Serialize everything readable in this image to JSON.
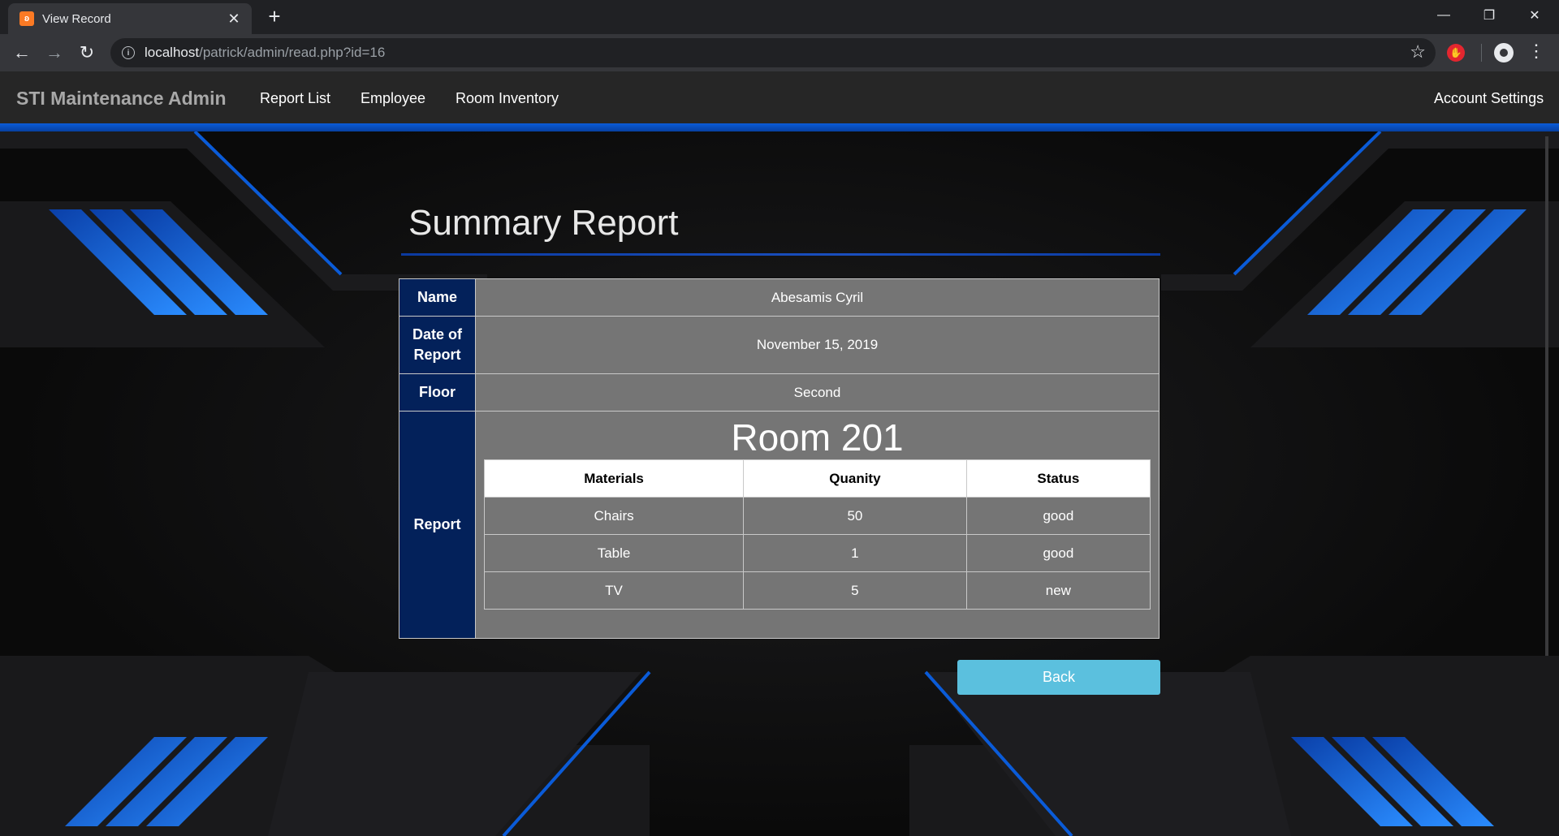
{
  "browser": {
    "tab_title": "View Record",
    "tab_close": "✕",
    "new_tab": "+",
    "url_host": "localhost",
    "url_path": "/patrick/admin/read.php?id=16"
  },
  "navbar": {
    "brand": "STI Maintenance Admin",
    "links": [
      "Report List",
      "Employee",
      "Room Inventory"
    ],
    "account": "Account Settings"
  },
  "page": {
    "heading": "Summary Report",
    "rows": {
      "name_label": "Name",
      "name_value": "Abesamis Cyril",
      "date_label": "Date of Report",
      "date_value": "November 15, 2019",
      "floor_label": "Floor",
      "floor_value": "Second",
      "report_label": "Report"
    },
    "room_title": "Room 201",
    "table": {
      "headers": [
        "Materials",
        "Quanity",
        "Status"
      ],
      "rows": [
        [
          "Chairs",
          "50",
          "good"
        ],
        [
          "Table",
          "1",
          "good"
        ],
        [
          "TV",
          "5",
          "new"
        ]
      ]
    },
    "back_button": "Back"
  },
  "colors": {
    "accent_blue": "#0a5bd8",
    "label_bg": "#03215a",
    "value_bg": "#757575",
    "back_button": "#5bc0de"
  }
}
